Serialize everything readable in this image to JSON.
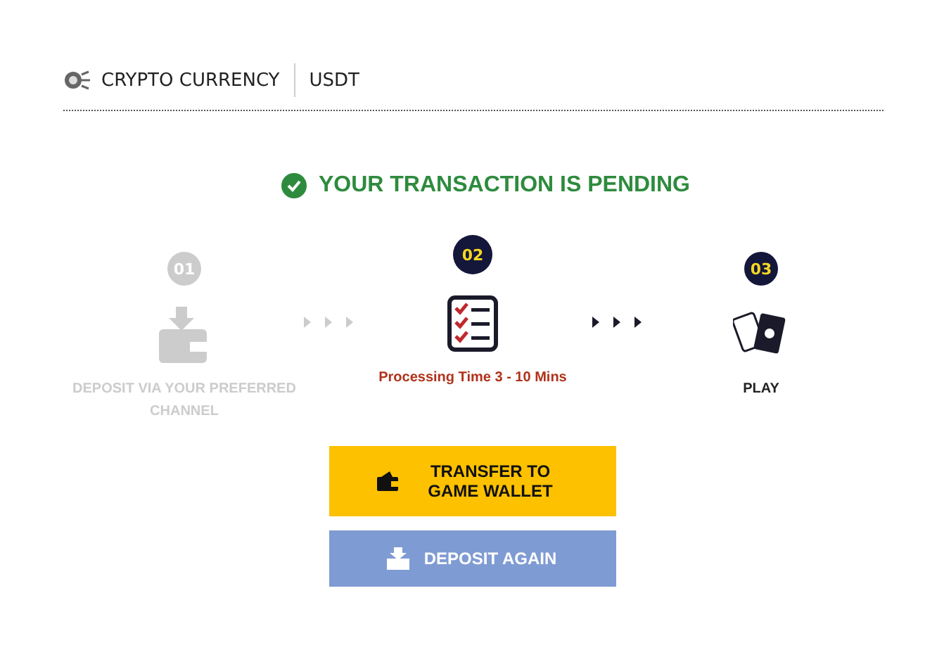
{
  "header": {
    "category": "CRYPTO CURRENCY",
    "currency": "USDT"
  },
  "status": {
    "message": "YOUR TRANSACTION IS PENDING"
  },
  "steps": [
    {
      "number": "01",
      "label": "DEPOSIT VIA YOUR PREFERRED CHANNEL",
      "disabled": true,
      "selected": false,
      "kind": "wallet"
    },
    {
      "number": "02",
      "label": "Processing Time 3 - 10 Mins",
      "disabled": false,
      "selected": true,
      "kind": "checklist"
    },
    {
      "number": "03",
      "label": "PLAY",
      "disabled": false,
      "selected": false,
      "kind": "cards"
    }
  ],
  "buttons": [
    {
      "label": "TRANSFER TO GAME WALLET",
      "kind": "primary"
    },
    {
      "label": "DEPOSIT AGAIN",
      "kind": "secondary"
    }
  ]
}
